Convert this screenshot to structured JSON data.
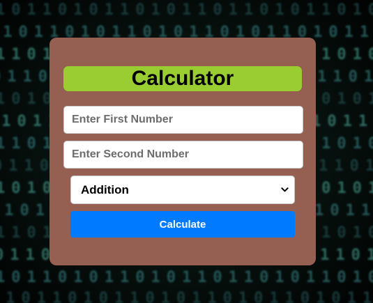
{
  "calculator": {
    "title": "Calculator",
    "first_number": {
      "value": "",
      "placeholder": "Enter First Number"
    },
    "second_number": {
      "value": "",
      "placeholder": "Enter Second Number"
    },
    "operation": {
      "selected": "Addition"
    },
    "calculate_label": "Calculate"
  },
  "colors": {
    "card_background": "#955f51",
    "title_background": "#9acd32",
    "button_background": "#007bff",
    "page_background": "#08110e",
    "background_digits": "#2f6f70"
  }
}
